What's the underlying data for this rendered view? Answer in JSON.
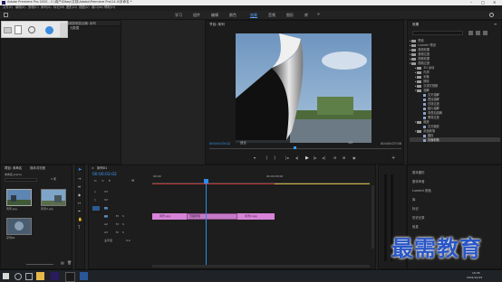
{
  "titlebar": {
    "title": "Adobe Premiere Pro 2020 - C:\\用户\\Dbay\\文档\\Adobe\\Premiere Pro\\14.0\\未命名 *"
  },
  "menu": [
    "文件(F)",
    "编辑(E)",
    "剪辑(C)",
    "序列(S)",
    "标记(M)",
    "图形(G)",
    "视图(V)",
    "窗口(W)",
    "帮助(H)"
  ],
  "workspaces": [
    "学习",
    "组件",
    "编辑",
    "颜色",
    "效果",
    "音频",
    "图形",
    "库"
  ],
  "workspace_active": "效果",
  "top_left_panel": {
    "tabs": [
      "效果控件",
      "音频剪辑混合器: 序列"
    ],
    "tab2": "元数据"
  },
  "program_monitor": {
    "tab": "节目: 序列",
    "timecode_left": "00:00:03:02",
    "fit": "适合",
    "ratio": "1/2",
    "timecode_right": "00:00:07:00"
  },
  "effects_panel": {
    "tab": "效果",
    "items": [
      {
        "label": "预设",
        "type": "folder",
        "indent": 1
      },
      {
        "label": "Lumetri 预设",
        "type": "folder",
        "indent": 1
      },
      {
        "label": "音频效果",
        "type": "folder",
        "indent": 1
      },
      {
        "label": "音频过渡",
        "type": "folder",
        "indent": 1
      },
      {
        "label": "视频效果",
        "type": "folder",
        "indent": 1
      },
      {
        "label": "视频过渡",
        "type": "folder",
        "indent": 1
      },
      {
        "label": "3D 运动",
        "type": "folder",
        "indent": 2
      },
      {
        "label": "内滑",
        "type": "folder",
        "indent": 2
      },
      {
        "label": "划像",
        "type": "folder",
        "indent": 2
      },
      {
        "label": "擦除",
        "type": "folder",
        "indent": 2
      },
      {
        "label": "沉浸式视频",
        "type": "folder",
        "indent": 2
      },
      {
        "label": "溶解",
        "type": "folder",
        "indent": 2
      },
      {
        "label": "交叉溶解",
        "type": "fx",
        "indent": 3
      },
      {
        "label": "叠加溶解",
        "type": "fx",
        "indent": 3
      },
      {
        "label": "白场过渡",
        "type": "fx",
        "indent": 3
      },
      {
        "label": "胶片溶解",
        "type": "fx",
        "indent": 3
      },
      {
        "label": "非叠加溶解",
        "type": "fx",
        "indent": 3
      },
      {
        "label": "黑场过渡",
        "type": "fx",
        "indent": 3
      },
      {
        "label": "缩放",
        "type": "folder",
        "indent": 2
      },
      {
        "label": "交叉缩放",
        "type": "fx",
        "indent": 3
      },
      {
        "label": "页面剥落",
        "type": "folder",
        "indent": 2
      },
      {
        "label": "翻页",
        "type": "fx",
        "indent": 3
      },
      {
        "label": "页面剥落",
        "type": "fx",
        "indent": 3,
        "selected": true
      }
    ]
  },
  "project_panel": {
    "tabs": [
      "项目: 未命名",
      "媒体浏览器"
    ],
    "path": "未命名.prproj",
    "count": "3 项",
    "items": [
      {
        "label": "风景.jpg"
      },
      {
        "label": "风景2.jpg"
      },
      {
        "label": "序列01"
      }
    ]
  },
  "timeline": {
    "tab": "序列01",
    "timecode": "00:00:03:02",
    "ruler": [
      "00:00",
      "00:00:05:00"
    ],
    "tracks": [
      "V3",
      "V2",
      "V1",
      "A1",
      "A2",
      "A3"
    ],
    "master": "主声道",
    "master_value": "0.0",
    "clips": [
      {
        "label": "风景.jpg"
      },
      {
        "label": "页面剥落"
      },
      {
        "label": "风景2.jpg"
      }
    ]
  },
  "right_lower_panel": {
    "items": [
      "基本图形",
      "基本声音",
      "Lumetri 颜色",
      "库",
      "标记",
      "历史记录",
      "信息"
    ]
  },
  "taskbar": {
    "time": "10:35",
    "date": "2021/12/15"
  },
  "watermark": {
    "text": "最需教育"
  },
  "colors": {
    "clip": "#d883d8",
    "accent": "#2d8ceb",
    "playhead": "#2d8ceb",
    "transition": "#c47ac4"
  }
}
